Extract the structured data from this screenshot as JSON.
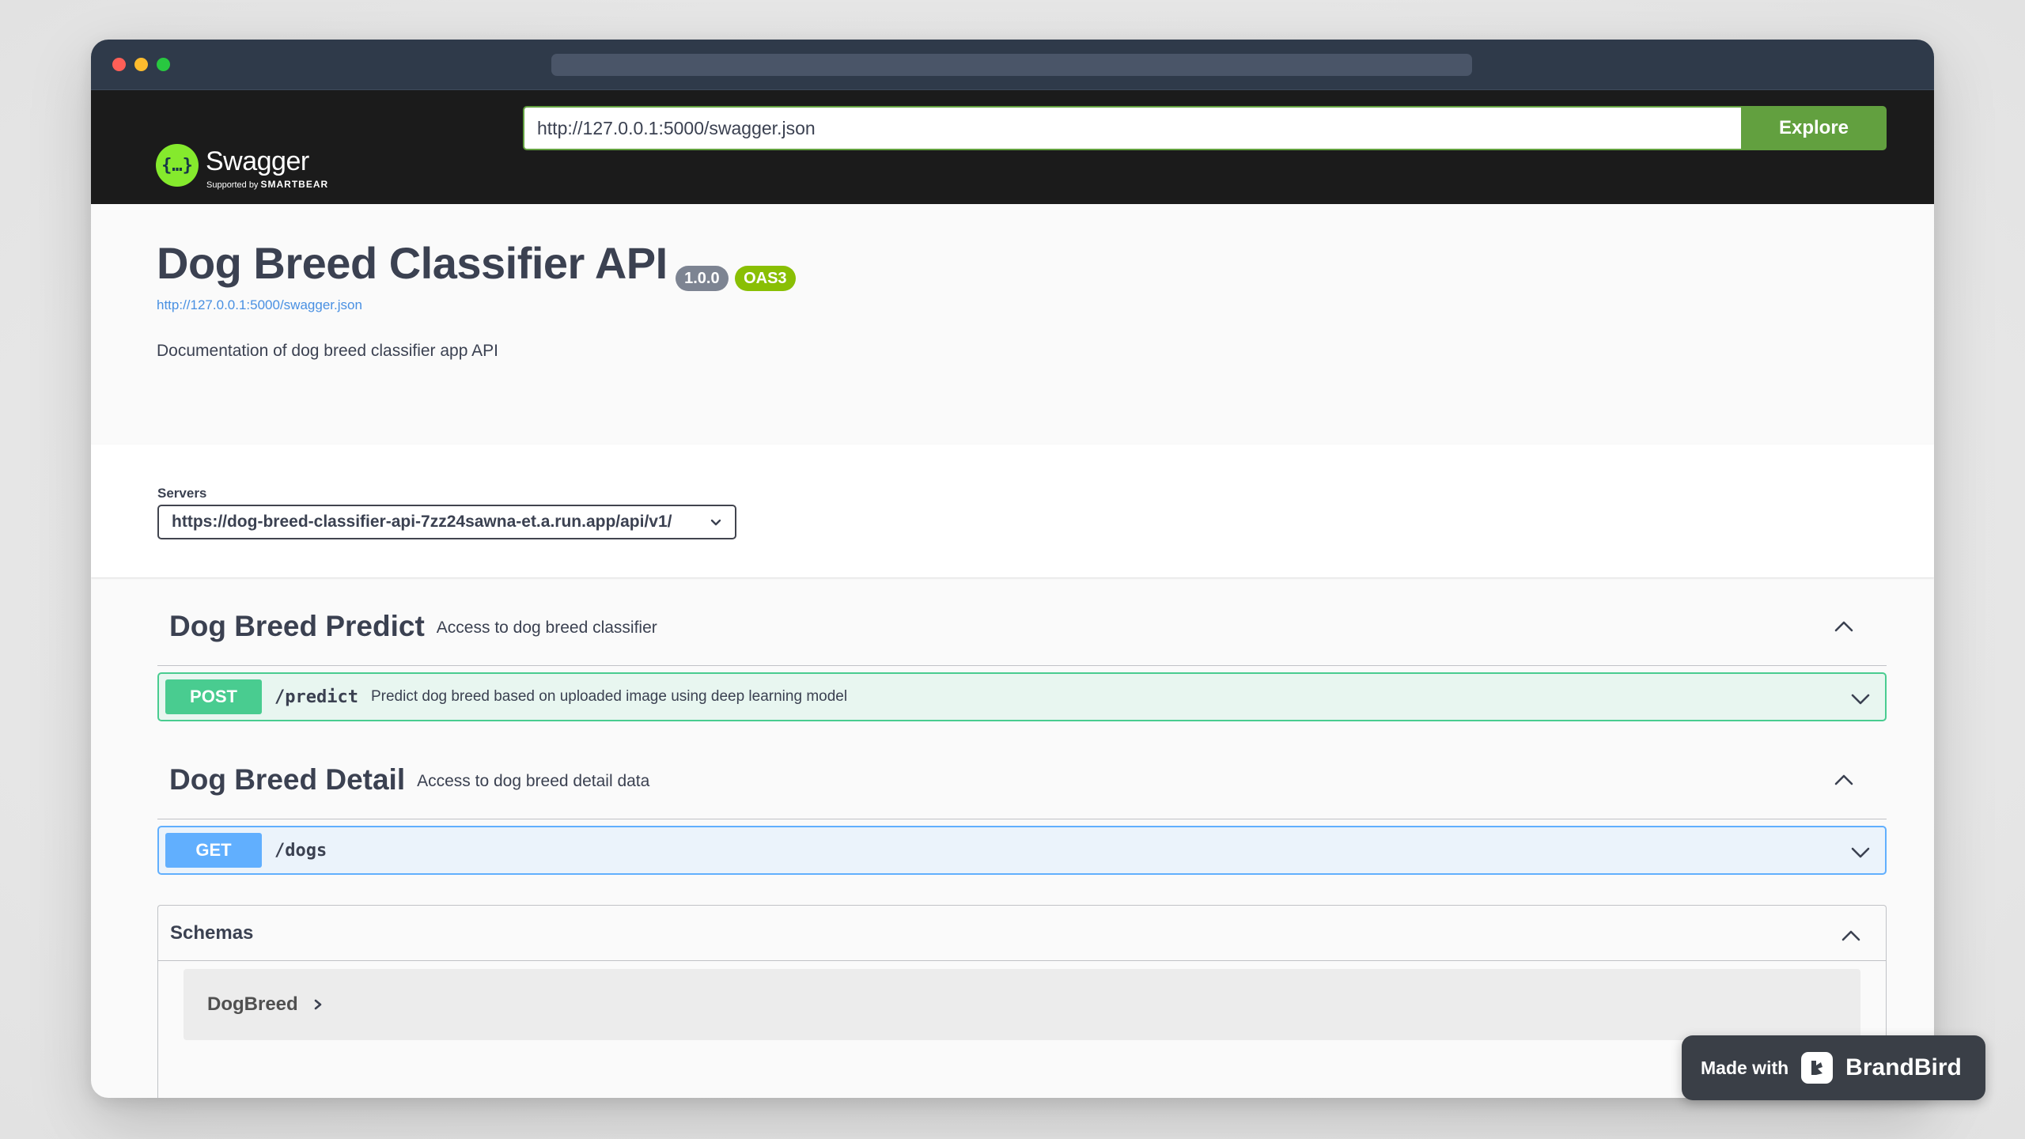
{
  "topbar": {
    "logo_text": "Swagger",
    "logo_subtext_prefix": "Supported by",
    "logo_subtext_brand": "SMARTBEAR",
    "spec_url_value": "http://127.0.0.1:5000/swagger.json",
    "explore_label": "Explore"
  },
  "info": {
    "title": "Dog Breed Classifier API",
    "version": "1.0.0",
    "oas_badge": "OAS3",
    "spec_link": "http://127.0.0.1:5000/swagger.json",
    "description": "Documentation of dog breed classifier app API"
  },
  "servers": {
    "label": "Servers",
    "selected": "https://dog-breed-classifier-api-7zz24sawna-et.a.run.app/api/v1/"
  },
  "tags": [
    {
      "name": "Dog Breed Predict",
      "description": "Access to dog breed classifier",
      "operations": [
        {
          "method": "POST",
          "path": "/predict",
          "summary": "Predict dog breed based on uploaded image using deep learning model"
        }
      ]
    },
    {
      "name": "Dog Breed Detail",
      "description": "Access to dog breed detail data",
      "operations": [
        {
          "method": "GET",
          "path": "/dogs",
          "summary": ""
        }
      ]
    }
  ],
  "schemas": {
    "title": "Schemas",
    "models": [
      "DogBreed"
    ]
  },
  "watermark": {
    "prefix": "Made with",
    "brand": "BrandBird"
  },
  "colors": {
    "post": "#49cc90",
    "get": "#61affe",
    "explore": "#62a03f",
    "oas": "#89bf04",
    "topbar": "#1b1b1b"
  }
}
